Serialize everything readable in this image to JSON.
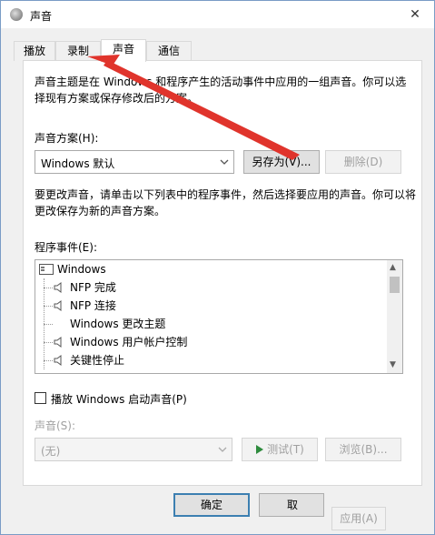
{
  "window": {
    "title": "声音",
    "close_glyph": "✕"
  },
  "tabs": [
    {
      "label": "播放"
    },
    {
      "label": "录制"
    },
    {
      "label": "声音"
    },
    {
      "label": "通信"
    }
  ],
  "sounds_tab": {
    "theme_description": "声音主题是在 Windows 和程序产生的活动事件中应用的一组声音。你可以选择现有方案或保存修改后的方案。",
    "scheme_label": "声音方案(H):",
    "scheme_value": "Windows 默认",
    "save_as_label": "另存为(V)...",
    "delete_label": "删除(D)",
    "change_description": "要更改声音，请单击以下列表中的程序事件，然后选择要应用的声音。你可以将更改保存为新的声音方案。",
    "events_label": "程序事件(E):",
    "events": [
      {
        "label": "Windows"
      },
      {
        "label": "NFP 完成"
      },
      {
        "label": "NFP 连接"
      },
      {
        "label": "Windows 更改主题"
      },
      {
        "label": "Windows 用户帐户控制"
      },
      {
        "label": "关键性停止"
      }
    ],
    "startup_sound_label": "播放 Windows 启动声音(P)",
    "sound_label": "声音(S):",
    "sound_value": "(无)",
    "test_label": "测试(T)",
    "browse_label": "浏览(B)..."
  },
  "footer": {
    "ok_label": "确定",
    "cancel_label": "取",
    "apply_label": "应用(A)"
  },
  "colors": {
    "annotation_arrow": "#e0342c",
    "test_play_icon": "#2e8b3d"
  }
}
